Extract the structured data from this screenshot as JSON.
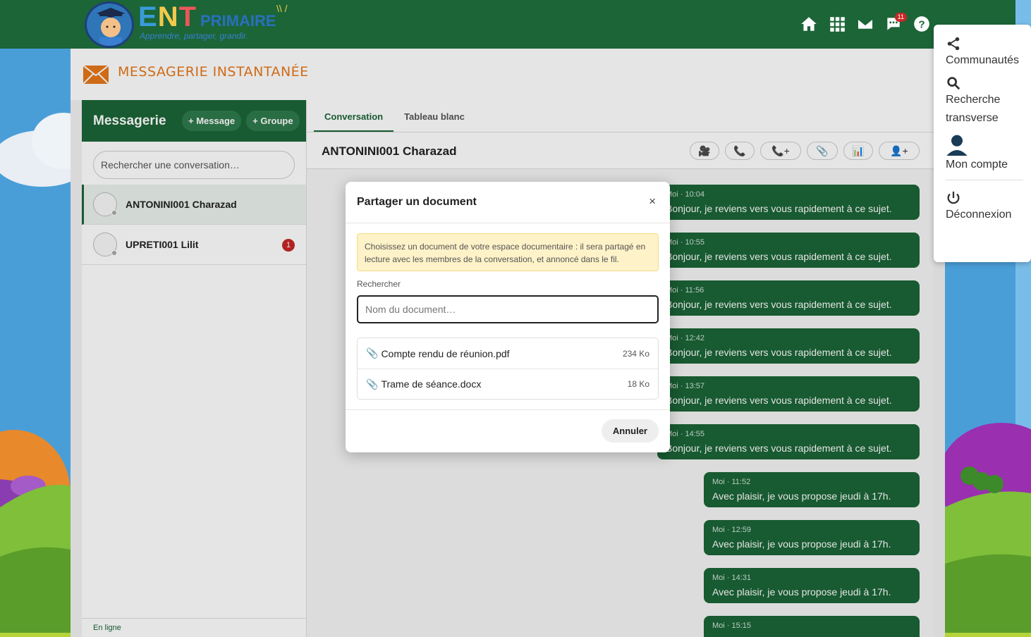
{
  "header": {
    "logo_ent": [
      "E",
      "N",
      "T"
    ],
    "logo_primaire": "PRIMAIRE",
    "logo_tagline": "Apprendre, partager, grandir.",
    "icons": [
      "home-icon",
      "apps-grid-icon",
      "mail-icon",
      "chat-icon",
      "help-icon"
    ],
    "chat_badge": "11"
  },
  "user_menu": {
    "items": [
      {
        "icon": "share-icon",
        "label": "Communautés"
      },
      {
        "icon": "search-icon",
        "label": "Recherche transverse"
      },
      {
        "icon": "user-icon",
        "label": "Mon compte"
      },
      {
        "icon": "power-icon",
        "label": "Déconnexion"
      }
    ]
  },
  "page": {
    "title": "MESSAGERIE INSTANTANÉE"
  },
  "left_panel": {
    "title": "Messagerie",
    "btn_message": "+ Message",
    "btn_group": "+ Groupe",
    "search_placeholder": "Rechercher une conversation…",
    "conversations": [
      {
        "name": "ANTONINI001 Charazad",
        "active": true,
        "badge": ""
      },
      {
        "name": "UPRETI001 Lilit",
        "active": false,
        "badge": "1"
      }
    ],
    "status": "En ligne"
  },
  "right_panel": {
    "tabs": [
      "Conversation",
      "Tableau blanc"
    ],
    "active_tab": "Conversation",
    "contact": "ANTONINI001 Charazad",
    "actions": [
      {
        "icon": "video-call-icon",
        "glyph": "🎥"
      },
      {
        "icon": "phone-icon",
        "glyph": "📞"
      },
      {
        "icon": "add-call-icon",
        "glyph": "📞+"
      },
      {
        "icon": "attach-icon",
        "glyph": "📎"
      },
      {
        "icon": "poll-icon",
        "glyph": "📊"
      },
      {
        "icon": "add-member-icon",
        "glyph": "👤+"
      }
    ],
    "messages": [
      {
        "meta": "Moi · 10:04",
        "text": "Bonjour, je reviens vers vous rapidement à ce sujet."
      },
      {
        "meta": "Moi · 10:55",
        "text": "Bonjour, je reviens vers vous rapidement à ce sujet."
      },
      {
        "meta": "Moi · 11:56",
        "text": "Bonjour, je reviens vers vous rapidement à ce sujet."
      },
      {
        "meta": "Moi · 12:42",
        "text": "Bonjour, je reviens vers vous rapidement à ce sujet."
      },
      {
        "meta": "Moi · 13:57",
        "text": "Bonjour, je reviens vers vous rapidement à ce sujet."
      },
      {
        "meta": "Moi · 14:55",
        "text": "Bonjour, je reviens vers vous rapidement à ce sujet."
      },
      {
        "meta": "Moi · 11:52",
        "text": "Avec plaisir, je vous propose jeudi à 17h."
      },
      {
        "meta": "Moi · 12:59",
        "text": "Avec plaisir, je vous propose jeudi à 17h."
      },
      {
        "meta": "Moi · 14:31",
        "text": "Avec plaisir, je vous propose jeudi à 17h."
      },
      {
        "meta": "Moi · 15:15",
        "text": ""
      }
    ]
  },
  "modal": {
    "title": "Partager un document",
    "close": "×",
    "notice": "Choisissez un document de votre espace documentaire : il sera partagé en lecture avec les membres de la conversation, et annoncé dans le fil.",
    "search_label": "Rechercher",
    "search_placeholder": "Nom du document…",
    "documents": [
      {
        "name": "Compte rendu de réunion.pdf",
        "size": "234 Ko"
      },
      {
        "name": "Trame de séance.docx",
        "size": "18 Ko"
      }
    ],
    "cancel": "Annuler"
  },
  "colors": {
    "brand_green": "#1b6537",
    "accent_orange": "#e7781a",
    "badge_red": "#c62828"
  }
}
